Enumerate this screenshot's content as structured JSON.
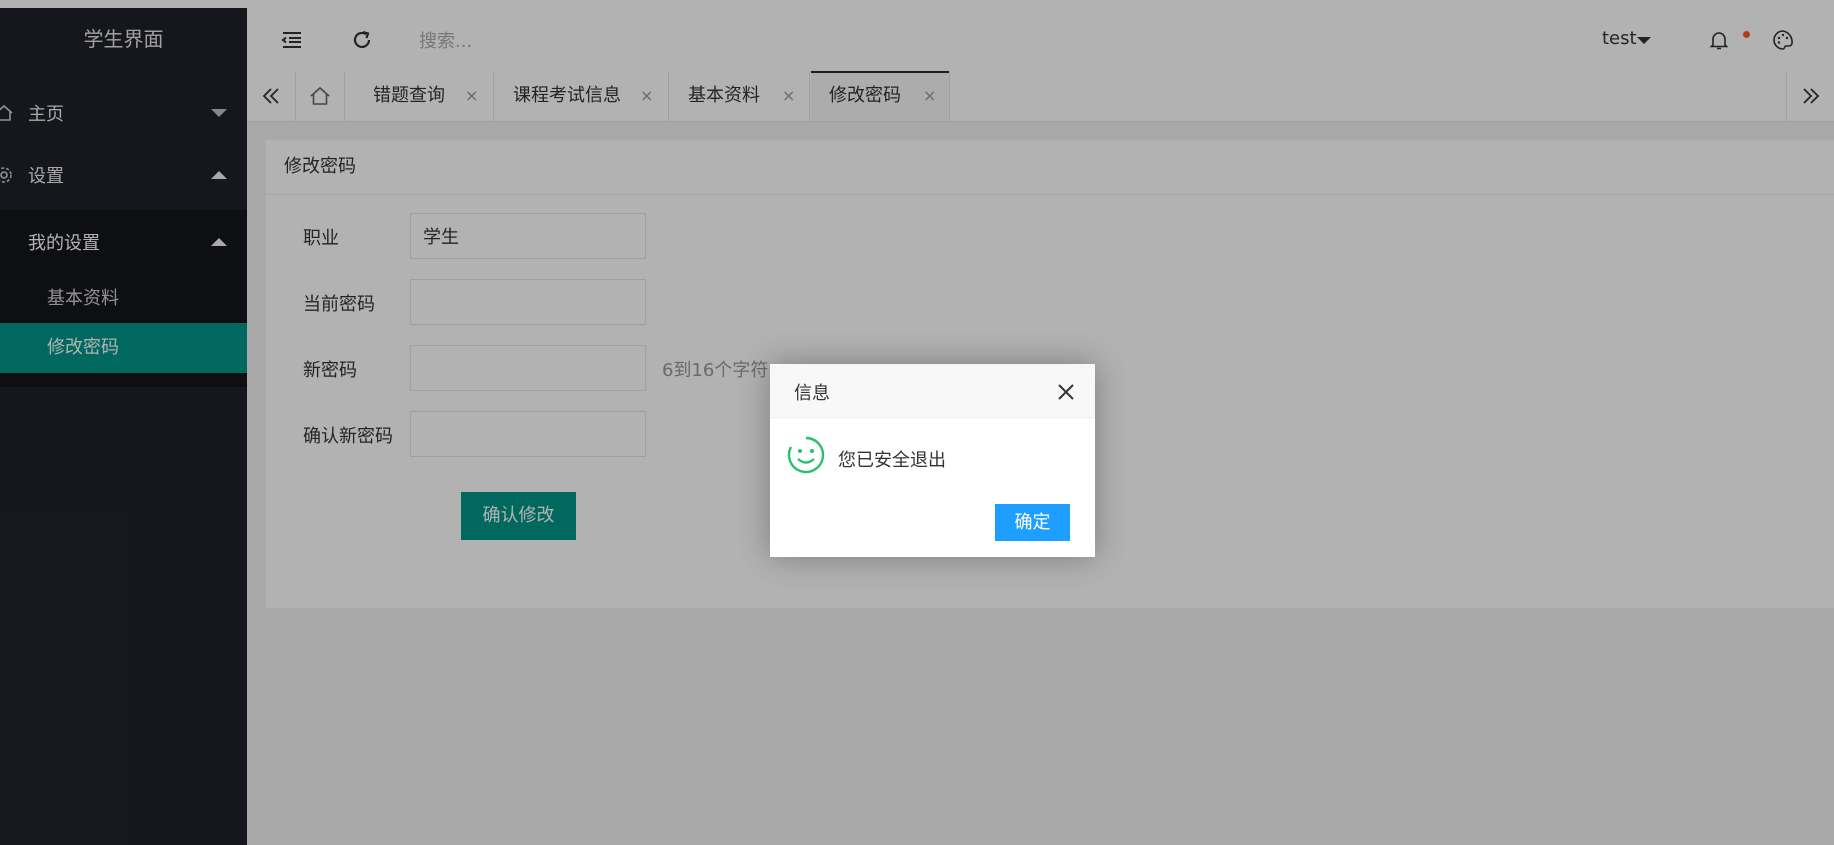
{
  "sidebar": {
    "title": "学生界面",
    "items": [
      {
        "label": "主页"
      },
      {
        "label": "设置"
      }
    ],
    "submenu": {
      "label": "我的设置",
      "items": [
        {
          "label": "基本资料"
        },
        {
          "label": "修改密码",
          "active": true
        }
      ]
    }
  },
  "header": {
    "search_placeholder": "搜索...",
    "user": "test"
  },
  "tabs": [
    {
      "label": "错题查询"
    },
    {
      "label": "课程考试信息"
    },
    {
      "label": "基本资料"
    },
    {
      "label": "修改密码",
      "active": true
    }
  ],
  "tab_close": "×",
  "card": {
    "title": "修改密码",
    "fields": [
      {
        "label": "职业",
        "value": "学生"
      },
      {
        "label": "当前密码",
        "value": ""
      },
      {
        "label": "新密码",
        "value": "",
        "hint": "6到16个字符"
      },
      {
        "label": "确认新密码",
        "value": ""
      }
    ],
    "submit_label": "确认修改"
  },
  "dialog": {
    "title": "信息",
    "message": "您已安全退出",
    "ok_label": "确定"
  },
  "colors": {
    "sidebar_bg": "#20222a",
    "accent": "#009688",
    "dialog_button": "#1e9fff",
    "notification_dot": "#ff5722",
    "smile_icon": "#2bc06f"
  }
}
